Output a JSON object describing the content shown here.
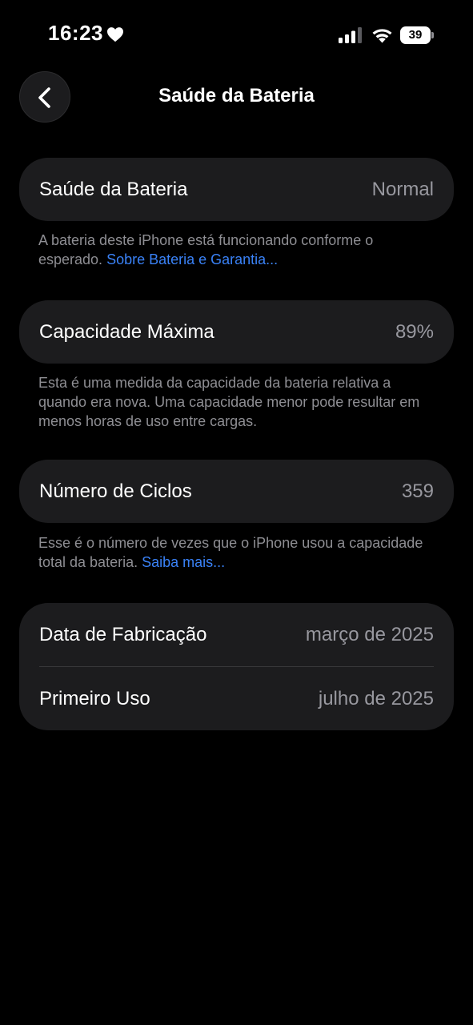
{
  "status_bar": {
    "time": "16:23",
    "battery_level": "39",
    "icons": [
      "heart-icon",
      "signal-icon",
      "wifi-icon",
      "battery-icon"
    ]
  },
  "nav": {
    "title": "Saúde da Bateria",
    "back_icon": "chevron-left-icon"
  },
  "battery_health": {
    "label": "Saúde da Bateria",
    "value": "Normal",
    "footnote_text": "A bateria deste iPhone está funcionando conforme o esperado. ",
    "footnote_link": "Sobre Bateria e Garantia..."
  },
  "max_capacity": {
    "label": "Capacidade Máxima",
    "value": "89%",
    "footnote_text": "Esta é uma medida da capacidade da bateria relativa a quando era nova. Uma capacidade menor pode resultar em menos horas de uso entre cargas."
  },
  "cycle_count": {
    "label": "Número de Ciclos",
    "value": "359",
    "footnote_text": "Esse é o número de vezes que o iPhone usou a capacidade total da bateria. ",
    "footnote_link": "Saiba mais..."
  },
  "dates": {
    "manufacture_label": "Data de Fabricação",
    "manufacture_value": "março de 2025",
    "first_use_label": "Primeiro Uso",
    "first_use_value": "julho de 2025"
  },
  "colors": {
    "background": "#000000",
    "card": "#1c1c1e",
    "secondary_text": "#8e8e93",
    "link": "#3a82f7"
  }
}
